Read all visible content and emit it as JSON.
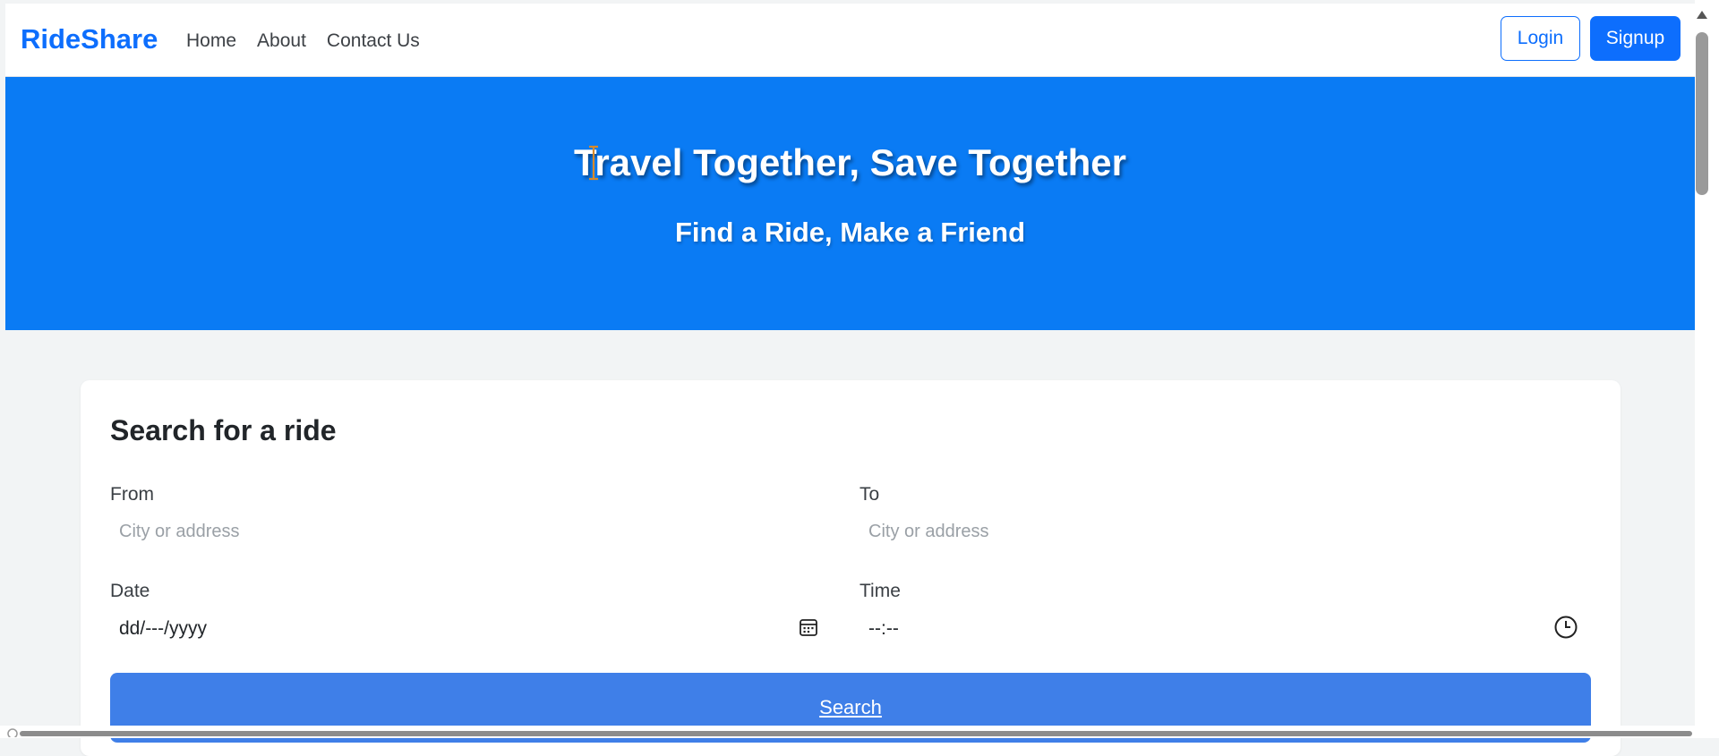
{
  "navbar": {
    "brand": "RideShare",
    "links": [
      "Home",
      "About",
      "Contact Us"
    ],
    "login_label": "Login",
    "signup_label": "Signup"
  },
  "hero": {
    "title": "Travel Together, Save Together",
    "subtitle": "Find a Ride, Make a Friend"
  },
  "search_card": {
    "title": "Search for a ride",
    "from_label": "From",
    "from_placeholder": "City or address",
    "to_label": "To",
    "to_placeholder": "City or address",
    "date_label": "Date",
    "date_value": "dd/---/yyyy",
    "time_label": "Time",
    "time_value": "--:--",
    "search_label": "Search"
  },
  "colors": {
    "brand": "#0d6efd",
    "hero_bg": "#0a7bf4",
    "search_button": "#3f7fe8",
    "page_bg": "#f2f4f5"
  },
  "icons": [
    "calendar-icon",
    "clock-icon",
    "text-cursor-icon"
  ]
}
